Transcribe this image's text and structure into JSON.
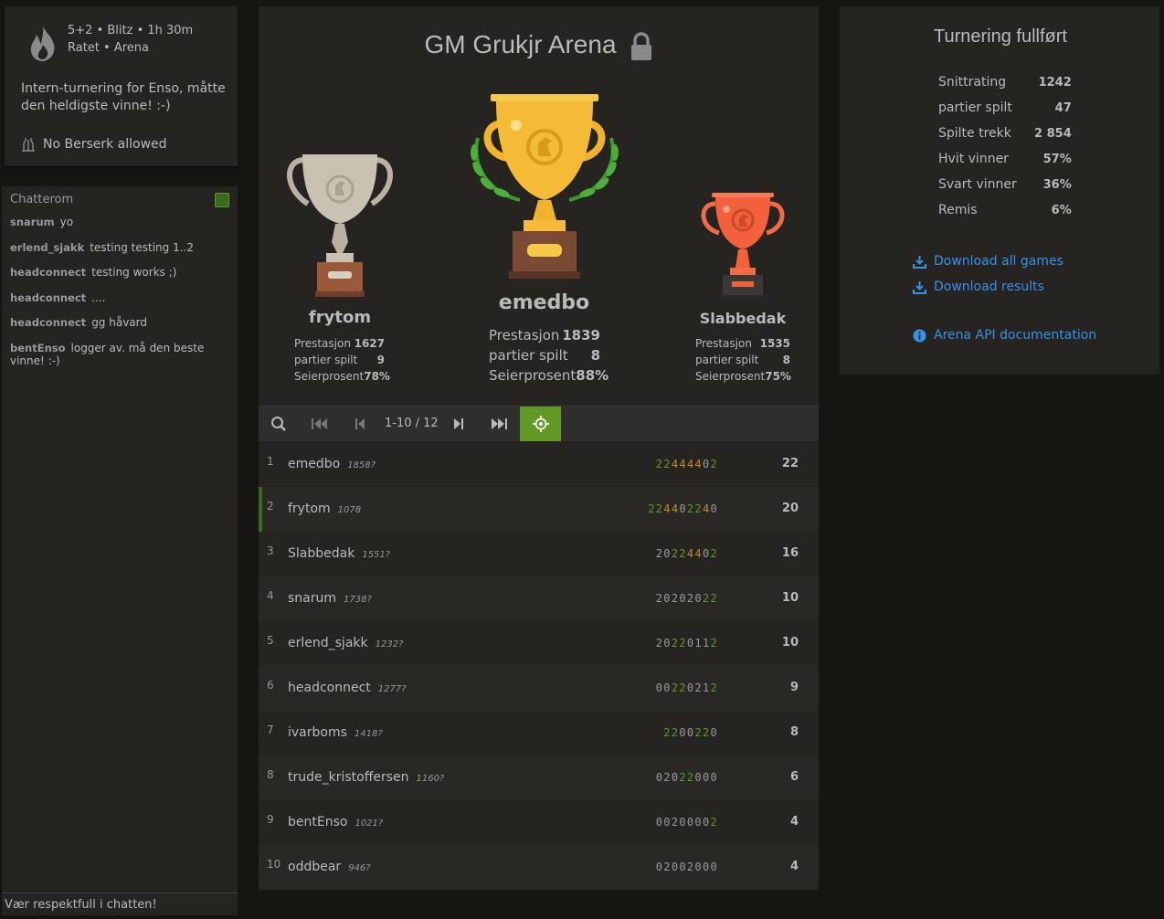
{
  "setup": {
    "line1": "5+2 • Blitz • 1h 30m",
    "line2": "Ratet • Arena",
    "description": "Intern-turnering for Enso, måtte den heldigste vinne! :-)",
    "berserk": "No Berserk allowed"
  },
  "chat": {
    "title": "Chatterom",
    "lines": [
      {
        "user": "snarum",
        "text": "yo"
      },
      {
        "user": "erlend_sjakk",
        "text": "testing testing 1..2"
      },
      {
        "user": "headconnect",
        "text": "testing works ;)"
      },
      {
        "user": "headconnect",
        "text": "...."
      },
      {
        "user": "headconnect",
        "text": "gg håvard"
      },
      {
        "user": "bentEnso",
        "text": "logger av. må den beste vinne! :-)"
      }
    ],
    "placeholder": "Vær respektfull i chatten!"
  },
  "tournament": {
    "title": "GM Grukjr Arena",
    "podium": {
      "first": {
        "name": "emedbo",
        "performance_label": "Prestasjon",
        "performance": "1839",
        "games_label": "partier spilt",
        "games": "8",
        "win_label": "Seierprosent",
        "win": "88%"
      },
      "second": {
        "name": "frytom",
        "performance_label": "Prestasjon",
        "performance": "1627",
        "games_label": "partier spilt",
        "games": "9",
        "win_label": "Seierprosent",
        "win": "78%"
      },
      "third": {
        "name": "Slabbedak",
        "performance_label": "Prestasjon",
        "performance": "1535",
        "games_label": "partier spilt",
        "games": "8",
        "win_label": "Seierprosent",
        "win": "75%"
      }
    },
    "pager": {
      "range": "1-10 / 12"
    },
    "colors": {
      "accent": "#629924",
      "orange": "#c98a26",
      "link": "#3692e7"
    },
    "standings": [
      {
        "rank": "1",
        "name": "emedbo",
        "rating": "1858?",
        "sheet": [
          [
            "2",
            "g"
          ],
          [
            "2",
            "g"
          ],
          [
            "4",
            "o"
          ],
          [
            "4",
            "o"
          ],
          [
            "4",
            "o"
          ],
          [
            "4",
            "o"
          ],
          [
            "0",
            "d"
          ],
          [
            "2",
            "g"
          ]
        ],
        "score": "22"
      },
      {
        "rank": "2",
        "name": "frytom",
        "rating": "1078",
        "sheet": [
          [
            "2",
            "g"
          ],
          [
            "2",
            "g"
          ],
          [
            "4",
            "o"
          ],
          [
            "4",
            "o"
          ],
          [
            "0",
            "d"
          ],
          [
            "2",
            "g"
          ],
          [
            "2",
            "g"
          ],
          [
            "4",
            "o"
          ],
          [
            "0",
            "d"
          ]
        ],
        "score": "20"
      },
      {
        "rank": "3",
        "name": "Slabbedak",
        "rating": "1551?",
        "sheet": [
          [
            "2",
            "d"
          ],
          [
            "0",
            "d"
          ],
          [
            "2",
            "g"
          ],
          [
            "2",
            "g"
          ],
          [
            "4",
            "o"
          ],
          [
            "4",
            "o"
          ],
          [
            "0",
            "d"
          ],
          [
            "2",
            "g"
          ]
        ],
        "score": "16"
      },
      {
        "rank": "4",
        "name": "snarum",
        "rating": "1738?",
        "sheet": [
          [
            "2",
            "d"
          ],
          [
            "0",
            "d"
          ],
          [
            "2",
            "d"
          ],
          [
            "0",
            "d"
          ],
          [
            "2",
            "d"
          ],
          [
            "0",
            "d"
          ],
          [
            "2",
            "g"
          ],
          [
            "2",
            "g"
          ]
        ],
        "score": "10"
      },
      {
        "rank": "5",
        "name": "erlend_sjakk",
        "rating": "1232?",
        "sheet": [
          [
            "2",
            "d"
          ],
          [
            "0",
            "d"
          ],
          [
            "2",
            "g"
          ],
          [
            "2",
            "g"
          ],
          [
            "0",
            "d"
          ],
          [
            "1",
            "d"
          ],
          [
            "1",
            "d"
          ],
          [
            "2",
            "g"
          ]
        ],
        "score": "10"
      },
      {
        "rank": "6",
        "name": "headconnect",
        "rating": "1277?",
        "sheet": [
          [
            "0",
            "d"
          ],
          [
            "0",
            "d"
          ],
          [
            "2",
            "g"
          ],
          [
            "2",
            "g"
          ],
          [
            "0",
            "d"
          ],
          [
            "2",
            "d"
          ],
          [
            "1",
            "d"
          ],
          [
            "2",
            "g"
          ]
        ],
        "score": "9"
      },
      {
        "rank": "7",
        "name": "ivarboms",
        "rating": "1418?",
        "sheet": [
          [
            "2",
            "g"
          ],
          [
            "2",
            "g"
          ],
          [
            "0",
            "d"
          ],
          [
            "0",
            "d"
          ],
          [
            "2",
            "g"
          ],
          [
            "2",
            "g"
          ],
          [
            "0",
            "d"
          ]
        ],
        "score": "8"
      },
      {
        "rank": "8",
        "name": "trude_kristoffersen",
        "rating": "1160?",
        "sheet": [
          [
            "0",
            "d"
          ],
          [
            "2",
            "d"
          ],
          [
            "0",
            "d"
          ],
          [
            "2",
            "g"
          ],
          [
            "2",
            "g"
          ],
          [
            "0",
            "d"
          ],
          [
            "0",
            "d"
          ],
          [
            "0",
            "d"
          ]
        ],
        "score": "6"
      },
      {
        "rank": "9",
        "name": "bentEnso",
        "rating": "1021?",
        "sheet": [
          [
            "0",
            "d"
          ],
          [
            "0",
            "d"
          ],
          [
            "2",
            "d"
          ],
          [
            "0",
            "d"
          ],
          [
            "0",
            "d"
          ],
          [
            "0",
            "d"
          ],
          [
            "0",
            "d"
          ],
          [
            "2",
            "g"
          ]
        ],
        "score": "4"
      },
      {
        "rank": "10",
        "name": "oddbear",
        "rating": "946?",
        "sheet": [
          [
            "0",
            "d"
          ],
          [
            "2",
            "d"
          ],
          [
            "0",
            "d"
          ],
          [
            "0",
            "d"
          ],
          [
            "2",
            "d"
          ],
          [
            "0",
            "d"
          ],
          [
            "0",
            "d"
          ],
          [
            "0",
            "d"
          ]
        ],
        "score": "4"
      }
    ]
  },
  "stats": {
    "title": "Turnering fullført",
    "rows": [
      {
        "label": "Snittrating",
        "value": "1242"
      },
      {
        "label": "partier spilt",
        "value": "47"
      },
      {
        "label": "Spilte trekk",
        "value": "2 854"
      },
      {
        "label": "Hvit vinner",
        "value": "57%"
      },
      {
        "label": "Svart vinner",
        "value": "36%"
      },
      {
        "label": "Remis",
        "value": "6%"
      }
    ],
    "download_all": "Download all games",
    "download_results": "Download results",
    "api_doc": "Arena API documentation"
  }
}
